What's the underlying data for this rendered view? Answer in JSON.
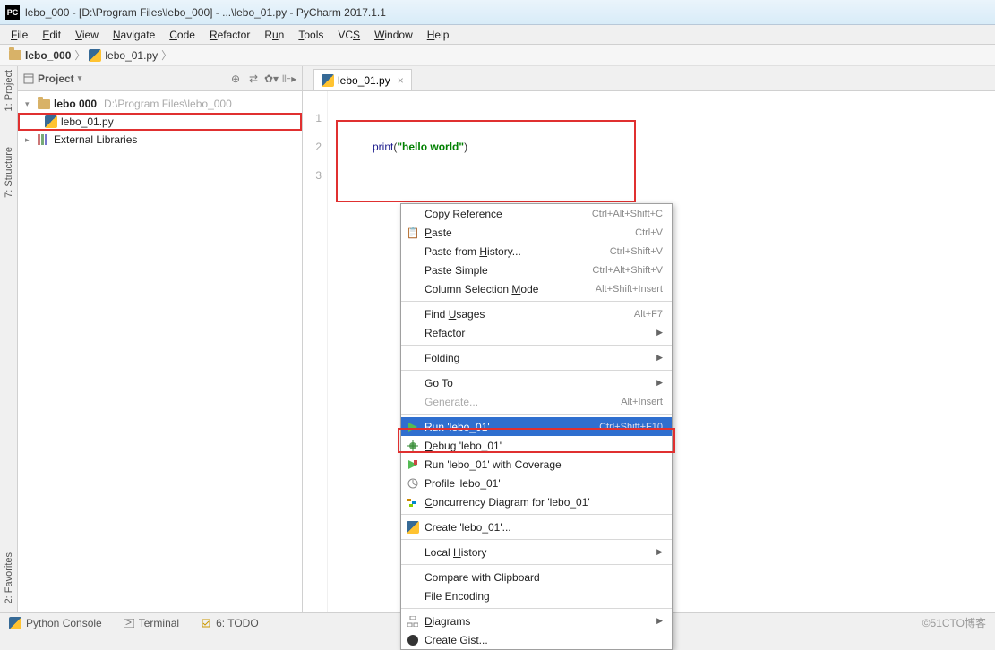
{
  "window": {
    "title": "lebo_000 - [D:\\Program Files\\lebo_000] - ...\\lebo_01.py - PyCharm 2017.1.1"
  },
  "menu": [
    "File",
    "Edit",
    "View",
    "Navigate",
    "Code",
    "Refactor",
    "Run",
    "Tools",
    "VCS",
    "Window",
    "Help"
  ],
  "breadcrumb": {
    "project": "lebo_000",
    "file": "lebo_01.py"
  },
  "sidebar": {
    "title": "Project",
    "root_name": "lebo 000",
    "root_path": "D:\\Program Files\\lebo_000",
    "file": "lebo_01.py",
    "ext_lib": "External Libraries"
  },
  "left_tabs": {
    "project": "1: Project",
    "structure": "7: Structure",
    "favorites": "2: Favorites"
  },
  "editor": {
    "tab": "lebo_01.py",
    "lines": [
      "1",
      "2",
      "3"
    ],
    "code_builtin": "print",
    "code_lparen": "(",
    "code_str": "\"hello world\"",
    "code_rparen": ")"
  },
  "context_menu": {
    "copy_ref": "Copy Reference",
    "copy_ref_sc": "Ctrl+Alt+Shift+C",
    "paste": "Paste",
    "paste_sc": "Ctrl+V",
    "paste_hist": "Paste from History...",
    "paste_hist_sc": "Ctrl+Shift+V",
    "paste_simple": "Paste Simple",
    "paste_simple_sc": "Ctrl+Alt+Shift+V",
    "col_sel": "Column Selection Mode",
    "col_sel_sc": "Alt+Shift+Insert",
    "find_usages": "Find Usages",
    "find_usages_sc": "Alt+F7",
    "refactor": "Refactor",
    "folding": "Folding",
    "goto": "Go To",
    "generate": "Generate...",
    "generate_sc": "Alt+Insert",
    "run": "Run 'lebo_01'",
    "run_sc": "Ctrl+Shift+F10",
    "debug": "Debug 'lebo_01'",
    "run_cov": "Run 'lebo_01' with Coverage",
    "profile": "Profile 'lebo_01'",
    "concurrency": "Concurrency Diagram for  'lebo_01'",
    "create": "Create 'lebo_01'...",
    "local_hist": "Local History",
    "compare_clip": "Compare with Clipboard",
    "file_enc": "File Encoding",
    "diagrams": "Diagrams",
    "create_gist": "Create Gist..."
  },
  "statusbar": {
    "python_console": "Python Console",
    "terminal": "Terminal",
    "todo": "6: TODO",
    "watermark": "©51CTO博客"
  }
}
